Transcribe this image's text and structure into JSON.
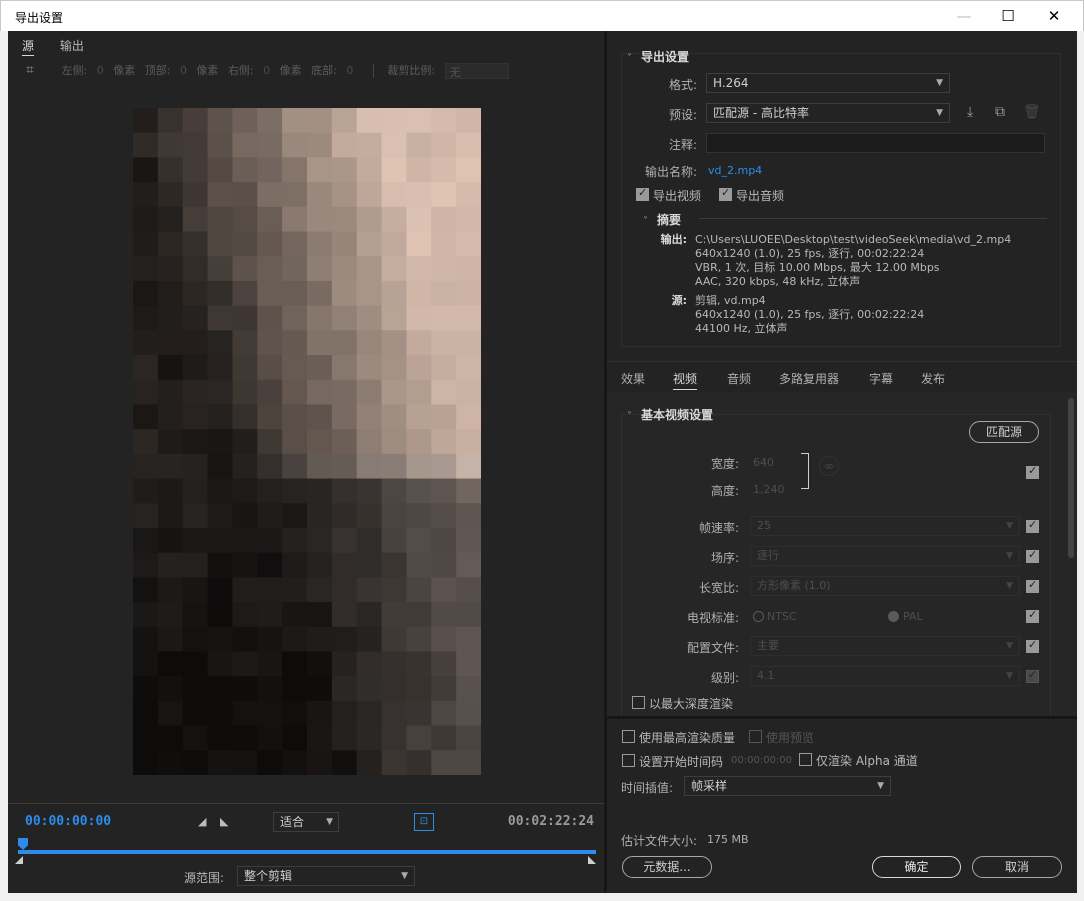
{
  "window": {
    "title": "导出设置",
    "min": "—",
    "max": "☐",
    "close": "✕"
  },
  "left": {
    "tabs": [
      {
        "label": "源",
        "active": true
      },
      {
        "label": "输出",
        "active": false
      }
    ],
    "crop": {
      "left_label": "左侧:",
      "left_value": "0",
      "left_unit": "像素",
      "top_label": "顶部:",
      "top_value": "0",
      "top_unit": "像素",
      "right_label": "右侧:",
      "right_value": "0",
      "right_unit": "像素",
      "bottom_label": "底部:",
      "bottom_value": "0",
      "ratio_label": "裁剪比例:",
      "ratio_value": "无"
    },
    "transport": {
      "start_tc": "00:00:00:00",
      "end_tc": "00:02:22:24",
      "fit_value": "适合",
      "range_label": "源范围:",
      "range_value": "整个剪辑"
    }
  },
  "export": {
    "section_title": "导出设置",
    "format_label": "格式:",
    "format_value": "H.264",
    "preset_label": "预设:",
    "preset_value": "匹配源 - 高比特率",
    "comment_label": "注释:",
    "comment_value": "",
    "output_name_label": "输出名称:",
    "output_name_value": "vd_2.mp4",
    "export_video_label": "导出视频",
    "export_video_checked": true,
    "export_audio_label": "导出音频",
    "export_audio_checked": true,
    "summary_title": "摘要",
    "summary_output_key": "输出:",
    "summary_output_lines": [
      "C:\\Users\\LUOEE\\Desktop\\test\\videoSeek\\media\\vd_2.mp4",
      "640x1240 (1.0), 25 fps, 逐行, 00:02:22:24",
      "VBR, 1 次, 目标 10.00 Mbps, 最大 12.00 Mbps",
      "AAC, 320 kbps, 48 kHz, 立体声"
    ],
    "summary_source_key": "源:",
    "summary_source_lines": [
      "剪辑, vd.mp4",
      "640x1240 (1.0), 25 fps, 逐行, 00:02:22:24",
      "44100 Hz, 立体声"
    ]
  },
  "tabs": [
    {
      "label": "效果",
      "active": false
    },
    {
      "label": "视频",
      "active": true
    },
    {
      "label": "音频",
      "active": false
    },
    {
      "label": "多路复用器",
      "active": false
    },
    {
      "label": "字幕",
      "active": false
    },
    {
      "label": "发布",
      "active": false
    }
  ],
  "video": {
    "section_title": "基本视频设置",
    "match_source_button": "匹配源",
    "width_label": "宽度:",
    "width_value": "640",
    "height_label": "高度:",
    "height_value": "1,240",
    "framerate_label": "帧速率:",
    "framerate_value": "25",
    "field_order_label": "场序:",
    "field_order_value": "逐行",
    "aspect_label": "长宽比:",
    "aspect_value": "方形像素 (1.0)",
    "tv_standard_label": "电视标准:",
    "ntsc_label": "NTSC",
    "pal_label": "PAL",
    "profile_label": "配置文件:",
    "profile_value": "主要",
    "level_label": "级别:",
    "level_value": "4.1",
    "max_depth_label": "以最大深度渲染"
  },
  "bottom": {
    "max_quality_label": "使用最高渲染质量",
    "use_previews_label": "使用预览",
    "set_start_tc_label": "设置开始时间码",
    "start_tc_value": "00:00:00:00",
    "alpha_only_label": "仅渲染 Alpha 通道",
    "time_interp_label": "时间插值:",
    "time_interp_value": "帧采样",
    "est_size_label": "估计文件大小:",
    "est_size_value": "175 MB",
    "metadata_button": "元数据...",
    "ok_button": "确定",
    "cancel_button": "取消"
  },
  "colors": {
    "accent": "#2d8ceb",
    "panel_bg": "#232323",
    "titlebar_bg": "#ffffff"
  }
}
